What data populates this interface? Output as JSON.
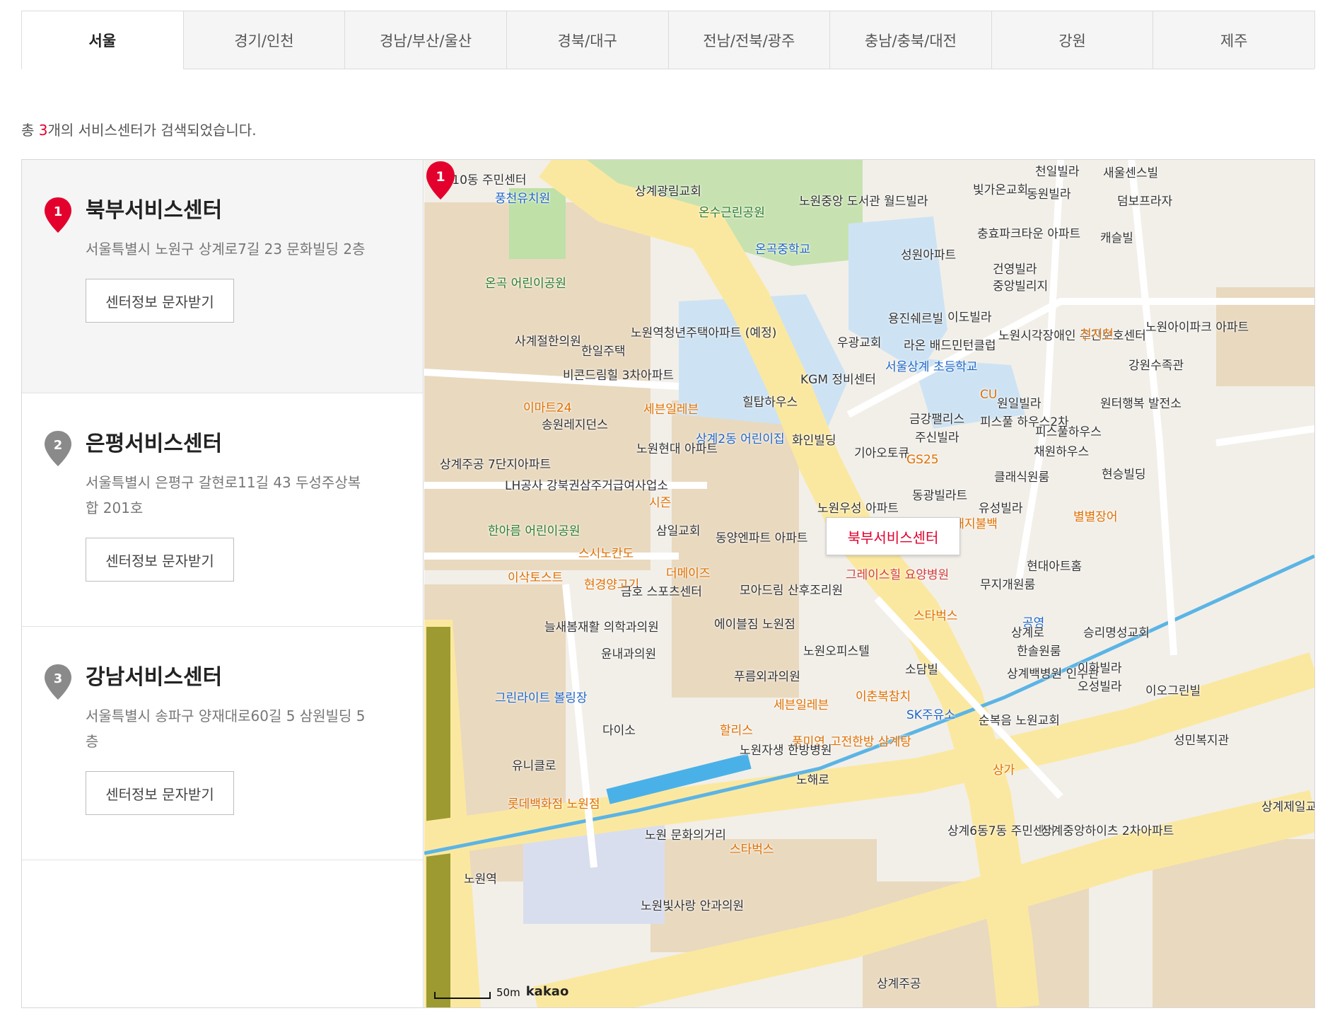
{
  "tabs": [
    {
      "label": "서울",
      "active": true
    },
    {
      "label": "경기/인천"
    },
    {
      "label": "경남/부산/울산"
    },
    {
      "label": "경북/대구"
    },
    {
      "label": "전남/전북/광주"
    },
    {
      "label": "충남/충북/대전"
    },
    {
      "label": "강원"
    },
    {
      "label": "제주"
    }
  ],
  "summary": {
    "prefix": "총 ",
    "count": "3",
    "suffix": "개의 서비스센터가 검색되었습니다."
  },
  "centers": [
    {
      "number": "1",
      "name": "북부서비스센터",
      "address": "서울특별시 노원구 상계로7길 23 문화빌딩 2층",
      "button": "센터정보 문자받기"
    },
    {
      "number": "2",
      "name": "은평서비스센터",
      "address": "서울특별시 은평구 갈현로11길 43 두성주상복합 201호",
      "button": "센터정보 문자받기"
    },
    {
      "number": "3",
      "name": "강남서비스센터",
      "address": "서울특별시 송파구 양재대로60길 5 삼원빌딩 5층",
      "button": "센터정보 문자받기"
    }
  ],
  "map": {
    "callout": "북부서비스센터",
    "marker_number": "1",
    "scale": "50m",
    "brand": "kakao",
    "labels": [
      {
        "text": "상계10동 주민센터",
        "style": ""
      },
      {
        "text": "풍천유치원",
        "style": "blue"
      },
      {
        "text": "상계광림교회",
        "style": ""
      },
      {
        "text": "온수근린공원",
        "style": "green"
      },
      {
        "text": "노원중앙 도서관",
        "style": ""
      },
      {
        "text": "월드빌라",
        "style": ""
      },
      {
        "text": "빛가온교회",
        "style": ""
      },
      {
        "text": "동원빌라",
        "style": ""
      },
      {
        "text": "천일빌라",
        "style": ""
      },
      {
        "text": "새울센스빌",
        "style": ""
      },
      {
        "text": "덤보프라자",
        "style": ""
      },
      {
        "text": "온곡중학교",
        "style": "blue"
      },
      {
        "text": "성원아파트",
        "style": ""
      },
      {
        "text": "충효파크타운 아파트",
        "style": ""
      },
      {
        "text": "캐슬빌",
        "style": ""
      },
      {
        "text": "온곡 어린이공원",
        "style": "green"
      },
      {
        "text": "건영빌라",
        "style": ""
      },
      {
        "text": "중앙빌리지",
        "style": ""
      },
      {
        "text": "노원역청년주택아파트 (예정)",
        "style": ""
      },
      {
        "text": "사계절한의원",
        "style": ""
      },
      {
        "text": "한일주택",
        "style": ""
      },
      {
        "text": "용진쉐르빌",
        "style": ""
      },
      {
        "text": "이도빌라",
        "style": ""
      },
      {
        "text": "노원시각장애인 주간보호센터",
        "style": ""
      },
      {
        "text": "천지천",
        "style": "orange"
      },
      {
        "text": "노원아이파크 아파트",
        "style": ""
      },
      {
        "text": "우광교회",
        "style": ""
      },
      {
        "text": "라온 배드민턴클럽",
        "style": ""
      },
      {
        "text": "서울상계 초등학교",
        "style": "blue"
      },
      {
        "text": "강원수족관",
        "style": ""
      },
      {
        "text": "비콘드림힐 3차아파트",
        "style": ""
      },
      {
        "text": "KGM 정비센터",
        "style": ""
      },
      {
        "text": "이마트24",
        "style": "orange"
      },
      {
        "text": "세븐일레븐",
        "style": "orange"
      },
      {
        "text": "힐탑하우스",
        "style": ""
      },
      {
        "text": "원일빌라",
        "style": ""
      },
      {
        "text": "원터행복 발전소",
        "style": ""
      },
      {
        "text": "CU",
        "style": "orange"
      },
      {
        "text": "송원레지던스",
        "style": ""
      },
      {
        "text": "상계2동 어린이집",
        "style": "blue"
      },
      {
        "text": "금강팰리스",
        "style": ""
      },
      {
        "text": "피스풀 하우스2차",
        "style": ""
      },
      {
        "text": "피스풀하우스",
        "style": ""
      },
      {
        "text": "화인빌딩",
        "style": ""
      },
      {
        "text": "주신빌라",
        "style": ""
      },
      {
        "text": "노원현대 아파트",
        "style": ""
      },
      {
        "text": "기아오토큐",
        "style": ""
      },
      {
        "text": "채원하우스",
        "style": ""
      },
      {
        "text": "상계주공 7단지아파트",
        "style": ""
      },
      {
        "text": "GS25",
        "style": "orange"
      },
      {
        "text": "클래식원룸",
        "style": ""
      },
      {
        "text": "현승빌딩",
        "style": ""
      },
      {
        "text": "LH공사 강북권삼주거급여사업소",
        "style": ""
      },
      {
        "text": "시즌",
        "style": "orange"
      },
      {
        "text": "동광빌라트",
        "style": ""
      },
      {
        "text": "노원우성 아파트",
        "style": ""
      },
      {
        "text": "유성빌라",
        "style": ""
      },
      {
        "text": "별별장어",
        "style": "orange"
      },
      {
        "text": "한아름 어린이공원",
        "style": "green"
      },
      {
        "text": "삼일교회",
        "style": ""
      },
      {
        "text": "동양엔파트 아파트",
        "style": ""
      },
      {
        "text": "엄마손 돼지불백",
        "style": "orange"
      },
      {
        "text": "스시노칸도",
        "style": "orange"
      },
      {
        "text": "현대아트홈",
        "style": ""
      },
      {
        "text": "이삭토스트",
        "style": "orange"
      },
      {
        "text": "현경양고기",
        "style": "orange"
      },
      {
        "text": "더메이즈",
        "style": "orange"
      },
      {
        "text": "그레이스힐 요양병원",
        "style": "red"
      },
      {
        "text": "무지개원룸",
        "style": ""
      },
      {
        "text": "금호 스포츠센터",
        "style": ""
      },
      {
        "text": "모아드림 산후조리원",
        "style": ""
      },
      {
        "text": "스타벅스",
        "style": "orange"
      },
      {
        "text": "공영",
        "style": "blue"
      },
      {
        "text": "승리명성교회",
        "style": ""
      },
      {
        "text": "늘새봄재활 의학과의원",
        "style": ""
      },
      {
        "text": "에이블짐 노원점",
        "style": ""
      },
      {
        "text": "노원오피스텔",
        "style": ""
      },
      {
        "text": "한솔원룸",
        "style": ""
      },
      {
        "text": "윤내과의원",
        "style": ""
      },
      {
        "text": "소담빌",
        "style": ""
      },
      {
        "text": "상계백병원 인수관",
        "style": ""
      },
      {
        "text": "이화빌라",
        "style": ""
      },
      {
        "text": "오성빌라",
        "style": ""
      },
      {
        "text": "푸름외과의원",
        "style": ""
      },
      {
        "text": "이오그린빌",
        "style": ""
      },
      {
        "text": "그린라이트 볼링장",
        "style": "blue"
      },
      {
        "text": "세븐일레븐",
        "style": "orange"
      },
      {
        "text": "이춘복참치",
        "style": "orange"
      },
      {
        "text": "다이소",
        "style": ""
      },
      {
        "text": "할리스",
        "style": "orange"
      },
      {
        "text": "풍미연",
        "style": "orange"
      },
      {
        "text": "고전한방 삼계탕",
        "style": "orange"
      },
      {
        "text": "SK주유소",
        "style": "blue"
      },
      {
        "text": "순복음 노원교회",
        "style": ""
      },
      {
        "text": "유니클로",
        "style": ""
      },
      {
        "text": "노원자생 한방병원",
        "style": ""
      },
      {
        "text": "성민복지관",
        "style": ""
      },
      {
        "text": "롯데백화점 노원점",
        "style": "orange"
      },
      {
        "text": "상가",
        "style": "orange"
      },
      {
        "text": "상계제일교",
        "style": ""
      },
      {
        "text": "노원 문화의거리",
        "style": ""
      },
      {
        "text": "스타벅스",
        "style": "orange"
      },
      {
        "text": "상계6동7동 주민센터",
        "style": ""
      },
      {
        "text": "상계중앙하이츠 2차아파트",
        "style": ""
      },
      {
        "text": "노원빛사랑 안과의원",
        "style": ""
      },
      {
        "text": "노원역",
        "style": ""
      },
      {
        "text": "상계주공",
        "style": ""
      },
      {
        "text": "노해로",
        "style": ""
      },
      {
        "text": "상계로",
        "style": ""
      }
    ]
  }
}
